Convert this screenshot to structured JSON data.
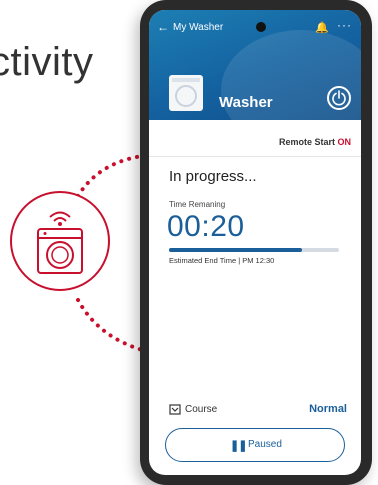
{
  "headline": "ctivity",
  "phone": {
    "top_bar": {
      "back_icon": "arrow-left-icon",
      "title": "My Washer",
      "bell_icon": "bell-icon",
      "more_icon": "more-dots-icon"
    },
    "appliance": {
      "name": "Washer",
      "power_icon": "power-icon"
    },
    "remote_start": {
      "label": "Remote Start",
      "state": "ON"
    },
    "status": {
      "title": "In progress...",
      "time_label": "Time Remaning",
      "time_value": "00:20",
      "progress_fraction": 0.78,
      "eta_text": "Estimated End Time | PM 12:30"
    },
    "course": {
      "icon": "course-icon",
      "label": "Course",
      "value": "Normal"
    },
    "action_button": {
      "icon": "pause-icon",
      "label": "Paused"
    }
  },
  "badge": {
    "icon": "smart-washer-icon"
  },
  "colors": {
    "accent_blue": "#1b5f9a",
    "brand_red": "#c8102e",
    "hero_blue": "#1461a0"
  }
}
